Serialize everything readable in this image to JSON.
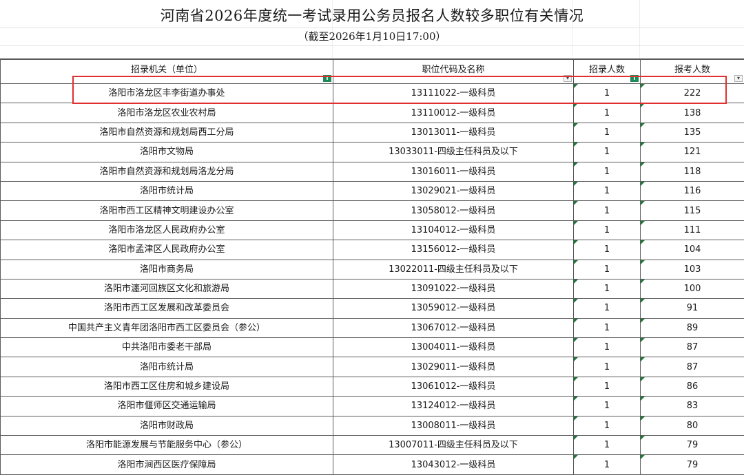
{
  "sheet": {
    "title": "河南省2026年度统一考试录用公务员报名人数较多职位有关情况",
    "subtitle": "（截至2026年1月10日17:00）"
  },
  "columns": {
    "agency": "招录机关（单位）",
    "position": "职位代码及名称",
    "quota": "招录人数",
    "applicants": "报考人数"
  },
  "filter_icons": {
    "agency": "filter-active-icon",
    "position": "dropdown-arrow-icon",
    "quota": "filter-active-icon",
    "applicants": "dropdown-arrow-icon"
  },
  "colors": {
    "highlight_box": "#e03030",
    "active_filter": "#1e8a5a",
    "note_marker": "#1f7a3a"
  },
  "rows": [
    {
      "agency": "洛阳市洛龙区丰李街道办事处",
      "position": "13111022-一级科员",
      "quota": "1",
      "applicants": "222"
    },
    {
      "agency": "洛阳市洛龙区农业农村局",
      "position": "13110012-一级科员",
      "quota": "1",
      "applicants": "138"
    },
    {
      "agency": "洛阳市自然资源和规划局西工分局",
      "position": "13013011-一级科员",
      "quota": "1",
      "applicants": "135"
    },
    {
      "agency": "洛阳市文物局",
      "position": "13033011-四级主任科员及以下",
      "quota": "1",
      "applicants": "121"
    },
    {
      "agency": "洛阳市自然资源和规划局洛龙分局",
      "position": "13016011-一级科员",
      "quota": "1",
      "applicants": "118"
    },
    {
      "agency": "洛阳市统计局",
      "position": "13029021-一级科员",
      "quota": "1",
      "applicants": "116"
    },
    {
      "agency": "洛阳市西工区精神文明建设办公室",
      "position": "13058012-一级科员",
      "quota": "1",
      "applicants": "115"
    },
    {
      "agency": "洛阳市洛龙区人民政府办公室",
      "position": "13104012-一级科员",
      "quota": "1",
      "applicants": "111"
    },
    {
      "agency": "洛阳市孟津区人民政府办公室",
      "position": "13156012-一级科员",
      "quota": "1",
      "applicants": "104"
    },
    {
      "agency": "洛阳市商务局",
      "position": "13022011-四级主任科员及以下",
      "quota": "1",
      "applicants": "103"
    },
    {
      "agency": "洛阳市瀍河回族区文化和旅游局",
      "position": "13091022-一级科员",
      "quota": "1",
      "applicants": "100"
    },
    {
      "agency": "洛阳市西工区发展和改革委员会",
      "position": "13059012-一级科员",
      "quota": "1",
      "applicants": "91"
    },
    {
      "agency": "中国共产主义青年团洛阳市西工区委员会（参公）",
      "position": "13067012-一级科员",
      "quota": "1",
      "applicants": "89"
    },
    {
      "agency": "中共洛阳市委老干部局",
      "position": "13004011-一级科员",
      "quota": "1",
      "applicants": "87"
    },
    {
      "agency": "洛阳市统计局",
      "position": "13029011-一级科员",
      "quota": "1",
      "applicants": "87"
    },
    {
      "agency": "洛阳市西工区住房和城乡建设局",
      "position": "13061012-一级科员",
      "quota": "1",
      "applicants": "86"
    },
    {
      "agency": "洛阳市偃师区交通运输局",
      "position": "13124012-一级科员",
      "quota": "1",
      "applicants": "83"
    },
    {
      "agency": "洛阳市财政局",
      "position": "13008011-一级科员",
      "quota": "1",
      "applicants": "80"
    },
    {
      "agency": "洛阳市能源发展与节能服务中心（参公）",
      "position": "13007011-四级主任科员及以下",
      "quota": "1",
      "applicants": "79"
    },
    {
      "agency": "洛阳市涧西区医疗保障局",
      "position": "13043012-一级科员",
      "quota": "1",
      "applicants": "79"
    }
  ]
}
